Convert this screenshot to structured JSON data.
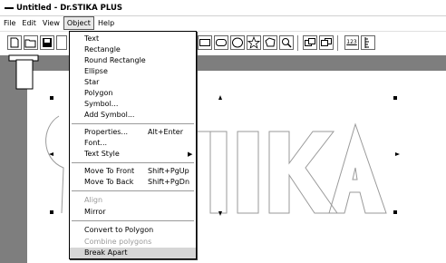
{
  "window": {
    "title": "Untitled - Dr.STIKA PLUS"
  },
  "menubar": [
    "File",
    "Edit",
    "View",
    "Object",
    "Help"
  ],
  "toolbar": {
    "fill_level": "123"
  },
  "dropdown": {
    "items": [
      {
        "label": "Text",
        "shortcut": "",
        "disabled": false,
        "submenu": false
      },
      {
        "label": "Rectangle",
        "shortcut": "",
        "disabled": false,
        "submenu": false
      },
      {
        "label": "Round Rectangle",
        "shortcut": "",
        "disabled": false,
        "submenu": false
      },
      {
        "label": "Ellipse",
        "shortcut": "",
        "disabled": false,
        "submenu": false
      },
      {
        "label": "Star",
        "shortcut": "",
        "disabled": false,
        "submenu": false
      },
      {
        "label": "Polygon",
        "shortcut": "",
        "disabled": false,
        "submenu": false
      },
      {
        "label": "Symbol...",
        "shortcut": "",
        "disabled": false,
        "submenu": false
      },
      {
        "label": "Add Symbol...",
        "shortcut": "",
        "disabled": false,
        "submenu": false
      },
      {
        "label": "Properties...",
        "shortcut": "Alt+Enter",
        "disabled": false,
        "submenu": false
      },
      {
        "label": "Font...",
        "shortcut": "",
        "disabled": false,
        "submenu": false
      },
      {
        "label": "Text Style",
        "shortcut": "",
        "disabled": false,
        "submenu": true
      },
      {
        "label": "Move To Front",
        "shortcut": "Shift+PgUp",
        "disabled": false,
        "submenu": false
      },
      {
        "label": "Move To Back",
        "shortcut": "Shift+PgDn",
        "disabled": false,
        "submenu": false
      },
      {
        "label": "Align",
        "shortcut": "",
        "disabled": true,
        "submenu": false
      },
      {
        "label": "Mirror",
        "shortcut": "",
        "disabled": false,
        "submenu": false
      },
      {
        "label": "Convert to Polygon",
        "shortcut": "",
        "disabled": false,
        "submenu": false
      },
      {
        "label": "Combine polygons",
        "shortcut": "",
        "disabled": true,
        "submenu": false
      },
      {
        "label": "Break Apart",
        "shortcut": "",
        "disabled": false,
        "submenu": false,
        "highlighted": true
      }
    ]
  },
  "colors": {
    "workspace": "#7e7e7e",
    "paper": "#ffffff",
    "menu_highlight": "#d6d6d6",
    "disabled_text": "#9a9a9a"
  }
}
